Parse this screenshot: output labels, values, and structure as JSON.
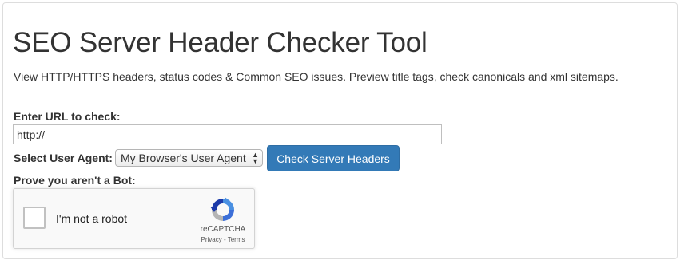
{
  "page": {
    "title": "SEO Server Header Checker Tool",
    "subtitle": "View HTTP/HTTPS headers, status codes & Common SEO issues. Preview title tags, check canonicals and xml sitemaps."
  },
  "form": {
    "url_label": "Enter URL to check:",
    "url_value": "http://",
    "agent_label": "Select User Agent:",
    "agent_selected": "My Browser's User Agent",
    "submit_label": "Check Server Headers",
    "bot_label": "Prove you aren't a Bot:"
  },
  "recaptcha": {
    "checkbox_label": "I'm not a robot",
    "brand": "reCAPTCHA",
    "links": "Privacy - Terms",
    "icon": "recaptcha-logo-icon"
  },
  "colors": {
    "button_primary": "#337ab7",
    "text": "#333333",
    "panel_border": "#dddddd"
  }
}
